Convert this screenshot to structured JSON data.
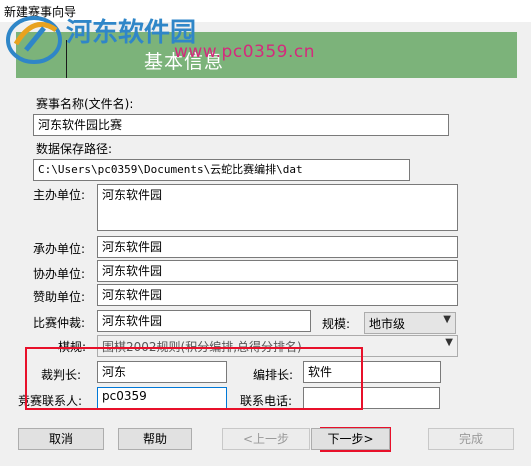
{
  "window": {
    "title": "新建赛事向导"
  },
  "banner": {
    "heading": "基本信息"
  },
  "watermark": {
    "site_name": "河东软件园",
    "url": "www.pc0359.cn"
  },
  "form": {
    "event_name_label": "赛事名称(文件名):",
    "event_name_value": "河东软件园比赛",
    "save_path_label": "数据保存路径:",
    "save_path_value": "C:\\Users\\pc0359\\Documents\\云蛇比赛编排\\dat",
    "host_label": "主办单位:",
    "host_value": "河东软件园",
    "organizer_label": "承办单位:",
    "organizer_value": "河东软件园",
    "coorganizer_label": "协办单位:",
    "coorganizer_value": "河东软件园",
    "sponsor_label": "赞助单位:",
    "sponsor_value": "河东软件园",
    "arbitration_label": "比赛仲裁:",
    "arbitration_value": "河东软件园",
    "scale_label": "规模:",
    "scale_value": "地市级",
    "rules_label": "棋规:",
    "rules_value": "围棋2002规则(积分编排,总得分排名)",
    "referee_label": "裁判长:",
    "referee_value": "河东",
    "arranger_label": "编排长:",
    "arranger_value": "软件",
    "contact_label": "竞赛联系人:",
    "contact_value": "pc0359",
    "phone_label": "联系电话:",
    "phone_value": ""
  },
  "buttons": {
    "cancel": "取消",
    "help": "帮助",
    "prev": "<上一步",
    "next": "下一步>",
    "finish": "完成"
  },
  "colors": {
    "banner": "#7cb37a",
    "highlight_box": "#e8102a",
    "accent": "#0078d7"
  }
}
